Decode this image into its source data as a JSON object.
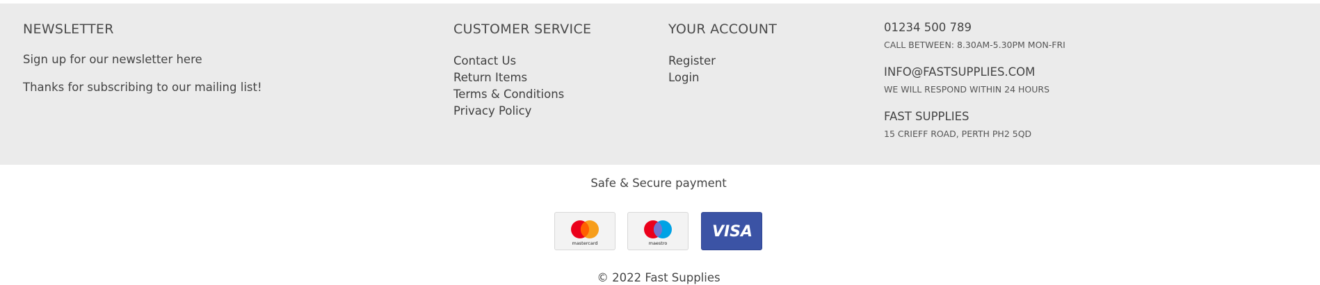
{
  "newsletter": {
    "heading": "NEWSLETTER",
    "signup_text": "Sign up for our newsletter here",
    "thanks_text": "Thanks for subscribing to our mailing list!"
  },
  "customer_service": {
    "heading": "CUSTOMER SERVICE",
    "links": [
      "Contact Us",
      "Return Items",
      "Terms & Conditions",
      "Privacy Policy"
    ]
  },
  "account": {
    "heading": "YOUR ACCOUNT",
    "links": [
      "Register",
      "Login"
    ]
  },
  "contact": {
    "phone": "01234 500 789",
    "phone_note": "CALL BETWEEN: 8.30AM-5.30PM MON-FRI",
    "email": "INFO@FASTSUPPLIES.COM",
    "email_note": "WE WILL RESPOND WITHIN 24 HOURS",
    "company": "FAST SUPPLIES",
    "address": "15 CRIEFF ROAD, PERTH PH2 5QD"
  },
  "payment": {
    "heading": "Safe & Secure payment",
    "cards": [
      {
        "icon": "mastercard-icon",
        "label": "mastercard"
      },
      {
        "icon": "maestro-icon",
        "label": "maestro"
      },
      {
        "icon": "visa-icon",
        "label": "VISA"
      }
    ]
  },
  "copyright": "© 2022 Fast Supplies",
  "colors": {
    "footer_bg": "#ebebeb",
    "text": "#4a4a4a",
    "visa_blue": "#3b53a5",
    "mc_red": "#eb001b",
    "mc_orange": "#f79e1b",
    "maestro_blue": "#00a2e5"
  }
}
